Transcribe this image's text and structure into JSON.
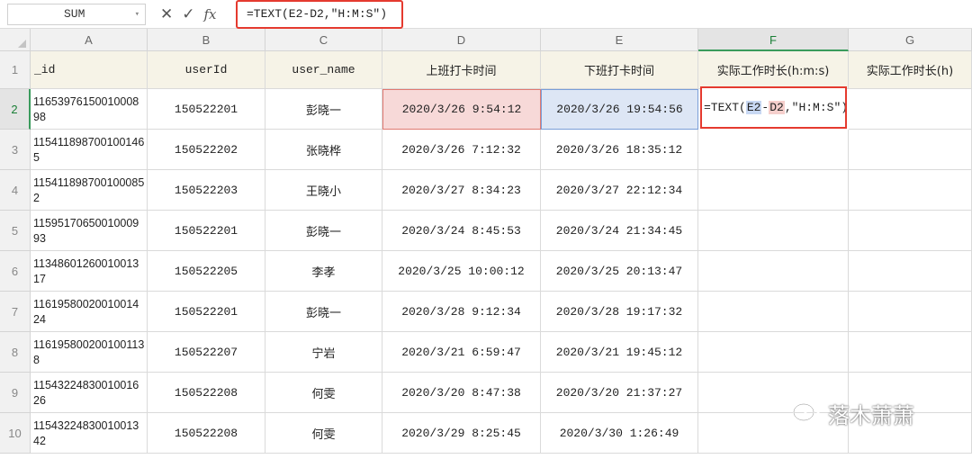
{
  "formula_bar": {
    "name_box": "SUM",
    "cancel_icon": "close-icon",
    "confirm_icon": "check-icon",
    "fx_label": "fx",
    "formula": "=TEXT(E2-D2,\"H:M:S\")"
  },
  "columns": [
    "A",
    "B",
    "C",
    "D",
    "E",
    "F",
    "G"
  ],
  "headers": [
    "_id",
    "userId",
    "user_name",
    "上班打卡时间",
    "下班打卡时间",
    "实际工作时长(h:m:s)",
    "实际工作时长(h)"
  ],
  "rows": [
    {
      "num": "2",
      "id": "1165397615001000898",
      "userId": "150522201",
      "name": "彭晓一",
      "start": "2020/3/26 9:54:12",
      "end": "2020/3/26 19:54:56",
      "f": "",
      "g": ""
    },
    {
      "num": "3",
      "id": "1154118987001001465",
      "userId": "150522202",
      "name": "张晓桦",
      "start": "2020/3/26 7:12:32",
      "end": "2020/3/26 18:35:12",
      "f": "",
      "g": ""
    },
    {
      "num": "4",
      "id": "1154118987001000852",
      "userId": "150522203",
      "name": "王晓小",
      "start": "2020/3/27 8:34:23",
      "end": "2020/3/27 22:12:34",
      "f": "",
      "g": ""
    },
    {
      "num": "5",
      "id": "1159517065001000993",
      "userId": "150522201",
      "name": "彭晓一",
      "start": "2020/3/24 8:45:53",
      "end": "2020/3/24 21:34:45",
      "f": "",
      "g": ""
    },
    {
      "num": "6",
      "id": "1134860126001001317",
      "userId": "150522205",
      "name": "李孝",
      "start": "2020/3/25 10:00:12",
      "end": "2020/3/25 20:13:47",
      "f": "",
      "g": ""
    },
    {
      "num": "7",
      "id": "1161958002001001424",
      "userId": "150522201",
      "name": "彭晓一",
      "start": "2020/3/28 9:12:34",
      "end": "2020/3/28 19:17:32",
      "f": "",
      "g": ""
    },
    {
      "num": "8",
      "id": "1161958002001001138",
      "userId": "150522207",
      "name": "宁岩",
      "start": "2020/3/21 6:59:47",
      "end": "2020/3/21 19:45:12",
      "f": "",
      "g": ""
    },
    {
      "num": "9",
      "id": "1154322483001001626",
      "userId": "150522208",
      "name": "何雯",
      "start": "2020/3/20 8:47:38",
      "end": "2020/3/20 21:37:27",
      "f": "",
      "g": ""
    },
    {
      "num": "10",
      "id": "1154322483001001342",
      "userId": "150522208",
      "name": "何雯",
      "start": "2020/3/29 8:25:45",
      "end": "2020/3/30 1:26:49",
      "f": "",
      "g": ""
    }
  ],
  "editing_cell": {
    "prefix": "=TEXT(",
    "ref1": "E2",
    "minus": "-",
    "ref2": "D2",
    "suffix": ",\"H:M:S\")"
  },
  "header_row_num": "1",
  "watermark": "落木萧萧",
  "colors": {
    "highlight_border": "#e53a2f",
    "ref_blue": "#dde6f5",
    "ref_red": "#f7d9d8",
    "active_green": "#3a9b5c"
  }
}
